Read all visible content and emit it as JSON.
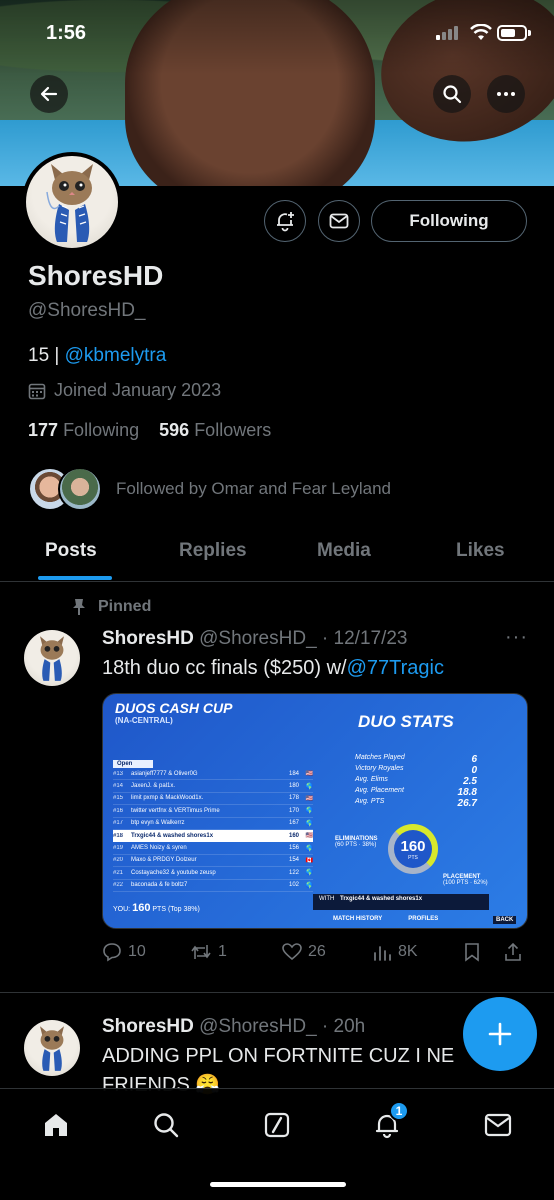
{
  "status_bar": {
    "time": "1:56"
  },
  "profile": {
    "name": "ShoresHD",
    "handle": "@ShoresHD_",
    "bio_prefix": "15 | ",
    "bio_link": "@kbmelytra",
    "joined": "Joined January 2023",
    "following_count": "177",
    "following_label": "Following",
    "followers_count": "596",
    "followers_label": "Followers",
    "followed_by": "Followed by Omar and Fear Leyland",
    "follow_button": "Following"
  },
  "tabs": [
    {
      "label": "Posts",
      "active": true
    },
    {
      "label": "Replies",
      "active": false
    },
    {
      "label": "Media",
      "active": false
    },
    {
      "label": "Likes",
      "active": false
    }
  ],
  "tweets": [
    {
      "pinned_label": "Pinned",
      "name": "ShoresHD",
      "handle": "@ShoresHD_",
      "date": "· 12/17/23",
      "text_prefix": "18th duo cc finals ($250) w/",
      "text_link": "@77Tragic",
      "replies": "10",
      "retweets": "1",
      "likes": "26",
      "views": "8K"
    },
    {
      "name": "ShoresHD",
      "handle": "@ShoresHD_",
      "date": "· 20h",
      "text_line1": "ADDING PPL ON FORTNITE CUZ I NE",
      "text_line2": "FRIENDS 😤"
    }
  ],
  "media": {
    "title": "DUOS CASH CUP",
    "region": "(NA-CENTRAL)",
    "open_label": "Open",
    "rows": [
      {
        "rank": "#13",
        "team": "asianjeff7777 & Oliver0G",
        "pts": "184",
        "flag": "🇺🇸"
      },
      {
        "rank": "#14",
        "team": "JaxenJ. & pal1x.",
        "pts": "180",
        "flag": "🌎"
      },
      {
        "rank": "#15",
        "team": "limit pxmp & MackWood1x.",
        "pts": "178",
        "flag": "🇺🇸"
      },
      {
        "rank": "#16",
        "team": "twitter vertfnx & VERTimus Prime",
        "pts": "170",
        "flag": "🌎"
      },
      {
        "rank": "#17",
        "team": "btp evyn & Walkerrz",
        "pts": "167",
        "flag": "🌎"
      },
      {
        "rank": "#18",
        "team": "Trxgic44 & washed shores1x",
        "pts": "160",
        "flag": "🇺🇸"
      },
      {
        "rank": "#19",
        "team": "AMES Noizy & syren",
        "pts": "156",
        "flag": "🌎"
      },
      {
        "rank": "#20",
        "team": "Maxo & PRDGY Dolzeur",
        "pts": "154",
        "flag": "🇨🇦"
      },
      {
        "rank": "#21",
        "team": "Costayache32 & youtube zeusp",
        "pts": "122",
        "flag": "🌎"
      },
      {
        "rank": "#22",
        "team": "baconada & fe boltz7",
        "pts": "102",
        "flag": "🌎"
      }
    ],
    "you_label": "YOU:",
    "you_pts": "160",
    "you_rest": "PTS (Top 38%)",
    "stats_title": "DUO STATS",
    "stats": [
      {
        "label": "Matches Played",
        "value": "6"
      },
      {
        "label": "Victory Royales",
        "value": "0"
      },
      {
        "label": "Avg. Elims",
        "value": "2.5"
      },
      {
        "label": "Avg. Placement",
        "value": "18.8"
      },
      {
        "label": "Avg. PTS",
        "value": "26.7"
      }
    ],
    "ring_value": "160",
    "ring_unit": "PTS",
    "elims_label": "ELIMINATIONS",
    "elims_sub": "(60 PTS · 38%)",
    "placement_label": "PLACEMENT",
    "placement_sub": "(100 PTS · 62%)",
    "with_label": "WITH",
    "with_names": "Trxgic44 & washed shores1x",
    "match_history": "MATCH HISTORY",
    "profiles": "PROFILES",
    "back": "BACK"
  },
  "nav": {
    "notifications_badge": "1"
  },
  "colors": {
    "accent": "#1d9bf0",
    "background": "#000000",
    "muted": "#71767b",
    "border": "#2f3336"
  }
}
